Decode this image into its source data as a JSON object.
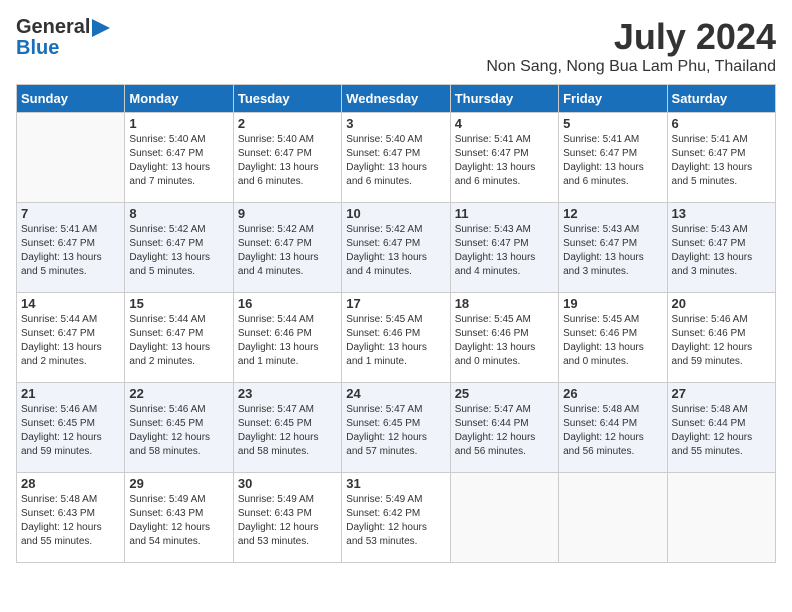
{
  "logo": {
    "general": "General",
    "blue": "Blue"
  },
  "title": {
    "month": "July 2024",
    "location": "Non Sang, Nong Bua Lam Phu, Thailand"
  },
  "headers": [
    "Sunday",
    "Monday",
    "Tuesday",
    "Wednesday",
    "Thursday",
    "Friday",
    "Saturday"
  ],
  "weeks": [
    [
      {
        "day": "",
        "sunrise": "",
        "sunset": "",
        "daylight": ""
      },
      {
        "day": "1",
        "sunrise": "Sunrise: 5:40 AM",
        "sunset": "Sunset: 6:47 PM",
        "daylight": "Daylight: 13 hours and 7 minutes."
      },
      {
        "day": "2",
        "sunrise": "Sunrise: 5:40 AM",
        "sunset": "Sunset: 6:47 PM",
        "daylight": "Daylight: 13 hours and 6 minutes."
      },
      {
        "day": "3",
        "sunrise": "Sunrise: 5:40 AM",
        "sunset": "Sunset: 6:47 PM",
        "daylight": "Daylight: 13 hours and 6 minutes."
      },
      {
        "day": "4",
        "sunrise": "Sunrise: 5:41 AM",
        "sunset": "Sunset: 6:47 PM",
        "daylight": "Daylight: 13 hours and 6 minutes."
      },
      {
        "day": "5",
        "sunrise": "Sunrise: 5:41 AM",
        "sunset": "Sunset: 6:47 PM",
        "daylight": "Daylight: 13 hours and 6 minutes."
      },
      {
        "day": "6",
        "sunrise": "Sunrise: 5:41 AM",
        "sunset": "Sunset: 6:47 PM",
        "daylight": "Daylight: 13 hours and 5 minutes."
      }
    ],
    [
      {
        "day": "7",
        "sunrise": "Sunrise: 5:41 AM",
        "sunset": "Sunset: 6:47 PM",
        "daylight": "Daylight: 13 hours and 5 minutes."
      },
      {
        "day": "8",
        "sunrise": "Sunrise: 5:42 AM",
        "sunset": "Sunset: 6:47 PM",
        "daylight": "Daylight: 13 hours and 5 minutes."
      },
      {
        "day": "9",
        "sunrise": "Sunrise: 5:42 AM",
        "sunset": "Sunset: 6:47 PM",
        "daylight": "Daylight: 13 hours and 4 minutes."
      },
      {
        "day": "10",
        "sunrise": "Sunrise: 5:42 AM",
        "sunset": "Sunset: 6:47 PM",
        "daylight": "Daylight: 13 hours and 4 minutes."
      },
      {
        "day": "11",
        "sunrise": "Sunrise: 5:43 AM",
        "sunset": "Sunset: 6:47 PM",
        "daylight": "Daylight: 13 hours and 4 minutes."
      },
      {
        "day": "12",
        "sunrise": "Sunrise: 5:43 AM",
        "sunset": "Sunset: 6:47 PM",
        "daylight": "Daylight: 13 hours and 3 minutes."
      },
      {
        "day": "13",
        "sunrise": "Sunrise: 5:43 AM",
        "sunset": "Sunset: 6:47 PM",
        "daylight": "Daylight: 13 hours and 3 minutes."
      }
    ],
    [
      {
        "day": "14",
        "sunrise": "Sunrise: 5:44 AM",
        "sunset": "Sunset: 6:47 PM",
        "daylight": "Daylight: 13 hours and 2 minutes."
      },
      {
        "day": "15",
        "sunrise": "Sunrise: 5:44 AM",
        "sunset": "Sunset: 6:47 PM",
        "daylight": "Daylight: 13 hours and 2 minutes."
      },
      {
        "day": "16",
        "sunrise": "Sunrise: 5:44 AM",
        "sunset": "Sunset: 6:46 PM",
        "daylight": "Daylight: 13 hours and 1 minute."
      },
      {
        "day": "17",
        "sunrise": "Sunrise: 5:45 AM",
        "sunset": "Sunset: 6:46 PM",
        "daylight": "Daylight: 13 hours and 1 minute."
      },
      {
        "day": "18",
        "sunrise": "Sunrise: 5:45 AM",
        "sunset": "Sunset: 6:46 PM",
        "daylight": "Daylight: 13 hours and 0 minutes."
      },
      {
        "day": "19",
        "sunrise": "Sunrise: 5:45 AM",
        "sunset": "Sunset: 6:46 PM",
        "daylight": "Daylight: 13 hours and 0 minutes."
      },
      {
        "day": "20",
        "sunrise": "Sunrise: 5:46 AM",
        "sunset": "Sunset: 6:46 PM",
        "daylight": "Daylight: 12 hours and 59 minutes."
      }
    ],
    [
      {
        "day": "21",
        "sunrise": "Sunrise: 5:46 AM",
        "sunset": "Sunset: 6:45 PM",
        "daylight": "Daylight: 12 hours and 59 minutes."
      },
      {
        "day": "22",
        "sunrise": "Sunrise: 5:46 AM",
        "sunset": "Sunset: 6:45 PM",
        "daylight": "Daylight: 12 hours and 58 minutes."
      },
      {
        "day": "23",
        "sunrise": "Sunrise: 5:47 AM",
        "sunset": "Sunset: 6:45 PM",
        "daylight": "Daylight: 12 hours and 58 minutes."
      },
      {
        "day": "24",
        "sunrise": "Sunrise: 5:47 AM",
        "sunset": "Sunset: 6:45 PM",
        "daylight": "Daylight: 12 hours and 57 minutes."
      },
      {
        "day": "25",
        "sunrise": "Sunrise: 5:47 AM",
        "sunset": "Sunset: 6:44 PM",
        "daylight": "Daylight: 12 hours and 56 minutes."
      },
      {
        "day": "26",
        "sunrise": "Sunrise: 5:48 AM",
        "sunset": "Sunset: 6:44 PM",
        "daylight": "Daylight: 12 hours and 56 minutes."
      },
      {
        "day": "27",
        "sunrise": "Sunrise: 5:48 AM",
        "sunset": "Sunset: 6:44 PM",
        "daylight": "Daylight: 12 hours and 55 minutes."
      }
    ],
    [
      {
        "day": "28",
        "sunrise": "Sunrise: 5:48 AM",
        "sunset": "Sunset: 6:43 PM",
        "daylight": "Daylight: 12 hours and 55 minutes."
      },
      {
        "day": "29",
        "sunrise": "Sunrise: 5:49 AM",
        "sunset": "Sunset: 6:43 PM",
        "daylight": "Daylight: 12 hours and 54 minutes."
      },
      {
        "day": "30",
        "sunrise": "Sunrise: 5:49 AM",
        "sunset": "Sunset: 6:43 PM",
        "daylight": "Daylight: 12 hours and 53 minutes."
      },
      {
        "day": "31",
        "sunrise": "Sunrise: 5:49 AM",
        "sunset": "Sunset: 6:42 PM",
        "daylight": "Daylight: 12 hours and 53 minutes."
      },
      {
        "day": "",
        "sunrise": "",
        "sunset": "",
        "daylight": ""
      },
      {
        "day": "",
        "sunrise": "",
        "sunset": "",
        "daylight": ""
      },
      {
        "day": "",
        "sunrise": "",
        "sunset": "",
        "daylight": ""
      }
    ]
  ]
}
